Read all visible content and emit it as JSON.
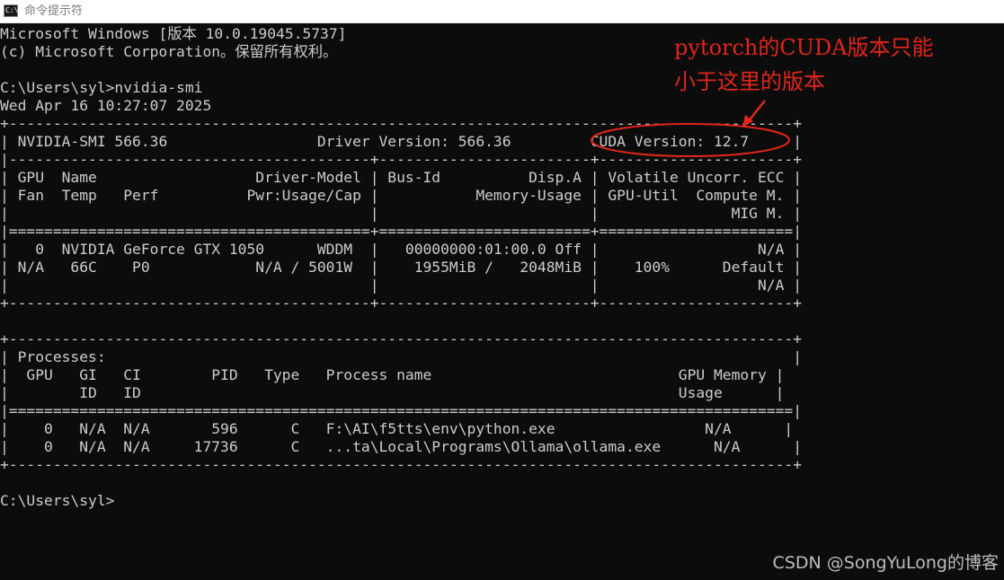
{
  "window": {
    "title": "命令提示符",
    "icon": "cmd-icon",
    "icon_glyph": "C:\\"
  },
  "console": {
    "lines": [
      "Microsoft Windows [版本 10.0.19045.5737]",
      "(c) Microsoft Corporation。保留所有权利。",
      "",
      "C:\\Users\\syl>nvidia-smi",
      "Wed Apr 16 10:27:07 2025",
      "+-----------------------------------------------------------------------------------------+",
      "| NVIDIA-SMI 566.36                 Driver Version: 566.36         CUDA Version: 12.7     |",
      "|-----------------------------------------+------------------------+----------------------+",
      "| GPU  Name                  Driver-Model | Bus-Id          Disp.A | Volatile Uncorr. ECC |",
      "| Fan  Temp   Perf          Pwr:Usage/Cap |           Memory-Usage | GPU-Util  Compute M. |",
      "|                                         |                        |               MIG M. |",
      "|=========================================+========================+======================|",
      "|   0  NVIDIA GeForce GTX 1050      WDDM  |   00000000:01:00.0 Off |                  N/A |",
      "| N/A   66C    P0            N/A / 5001W  |    1955MiB /   2048MiB |    100%      Default |",
      "|                                         |                        |                  N/A |",
      "+-----------------------------------------+------------------------+----------------------+",
      "",
      "+-----------------------------------------------------------------------------------------+",
      "| Processes:                                                                              |",
      "|  GPU   GI   CI        PID   Type   Process name                            GPU Memory |",
      "|        ID   ID                                                             Usage      |",
      "|=========================================================================================|",
      "|    0   N/A  N/A       596      C   F:\\AI\\f5tts\\env\\python.exe                 N/A      |",
      "|    0   N/A  N/A     17736      C   ...ta\\Local\\Programs\\Ollama\\ollama.exe      N/A      |",
      "+-----------------------------------------------------------------------------------------+",
      "",
      "C:\\Users\\syl>"
    ]
  },
  "annotation": {
    "line1": "pytorch的CUDA版本只能",
    "line2": "小于这里的版本",
    "color": "#e0261c"
  },
  "watermark": "CSDN @SongYuLong的博客"
}
